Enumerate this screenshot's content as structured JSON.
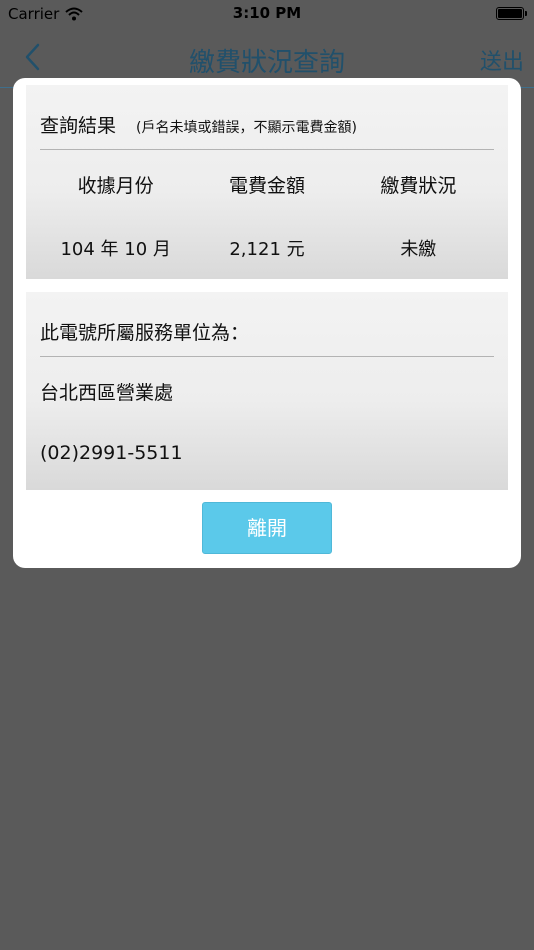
{
  "status_bar": {
    "carrier": "Carrier",
    "time": "3:10 PM"
  },
  "nav": {
    "title": "繳費狀況查詢",
    "action_label": "送出",
    "back_icon": "chevron-left-icon"
  },
  "dialog": {
    "result": {
      "title": "查詢結果",
      "note": "(戶名未填或錯誤，不顯示電費金額)",
      "columns": [
        "收據月份",
        "電費金額",
        "繳費狀況"
      ],
      "row": [
        "104 年 10 月",
        "2,121 元",
        "未繳"
      ]
    },
    "service": {
      "label": "此電號所屬服務單位為：",
      "unit": "台北西區營業處",
      "phone": "(02)2991-5511"
    },
    "leave_label": "離開"
  },
  "colors": {
    "overlay": "#5a5a5a",
    "nav_tint": "#21506b",
    "button": "#5bc9ea",
    "panel": "#ededed"
  }
}
